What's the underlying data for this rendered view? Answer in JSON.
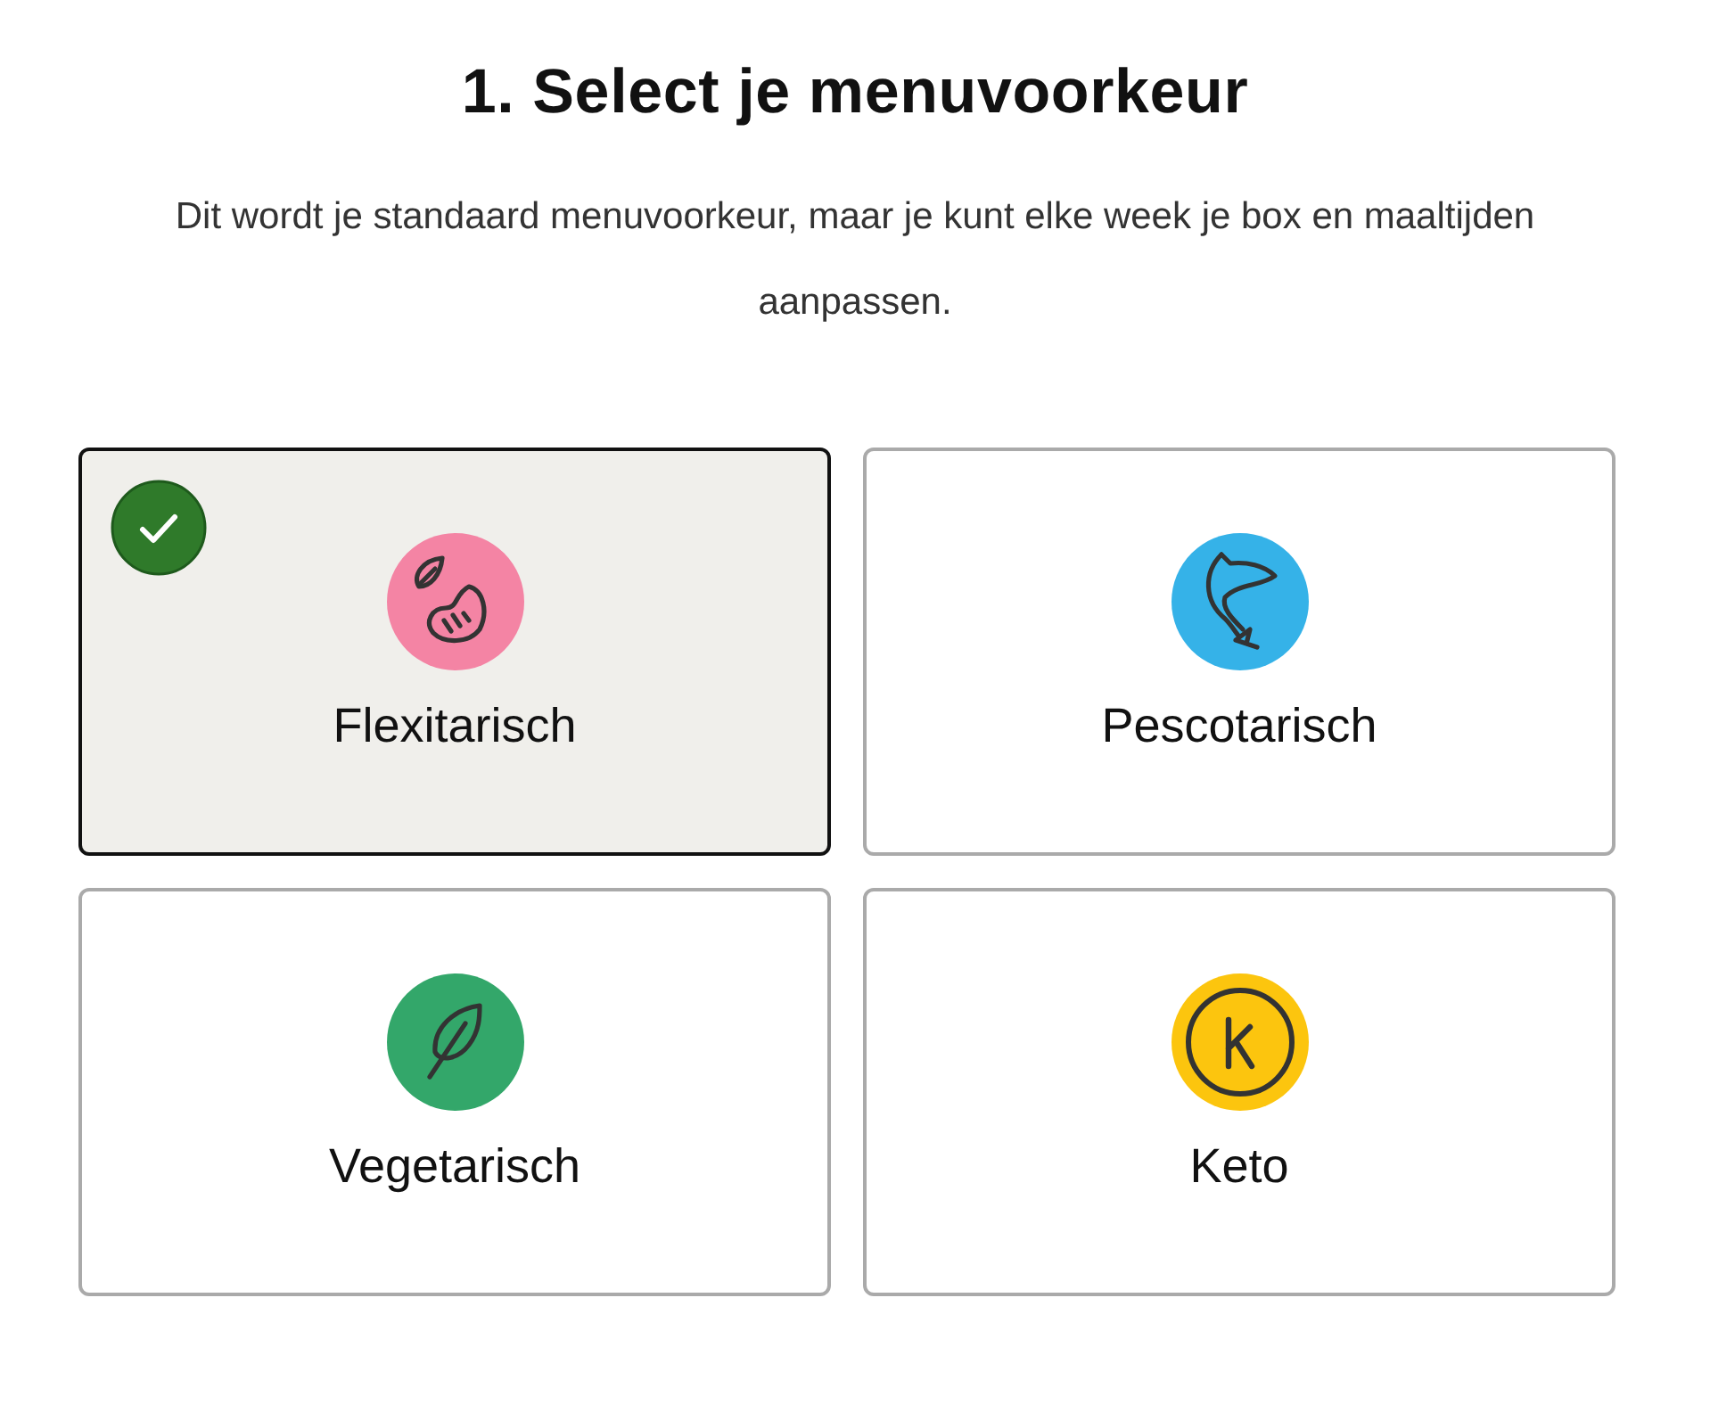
{
  "title": "1. Select je menuvoorkeur",
  "description": "Dit wordt je standaard menuvoorkeur, maar je kunt elke week je box en maaltijden aanpassen.",
  "options": [
    {
      "label": "Flexitarisch",
      "kind": "flexitarian",
      "color": "#f484a4",
      "selected": true
    },
    {
      "label": "Pescotarisch",
      "kind": "fish",
      "color": "#35b2e8",
      "selected": false
    },
    {
      "label": "Vegetarisch",
      "kind": "leaf",
      "color": "#33a76a",
      "selected": false
    },
    {
      "label": "Keto",
      "kind": "keto",
      "color": "#fcc50e",
      "selected": false
    }
  ]
}
